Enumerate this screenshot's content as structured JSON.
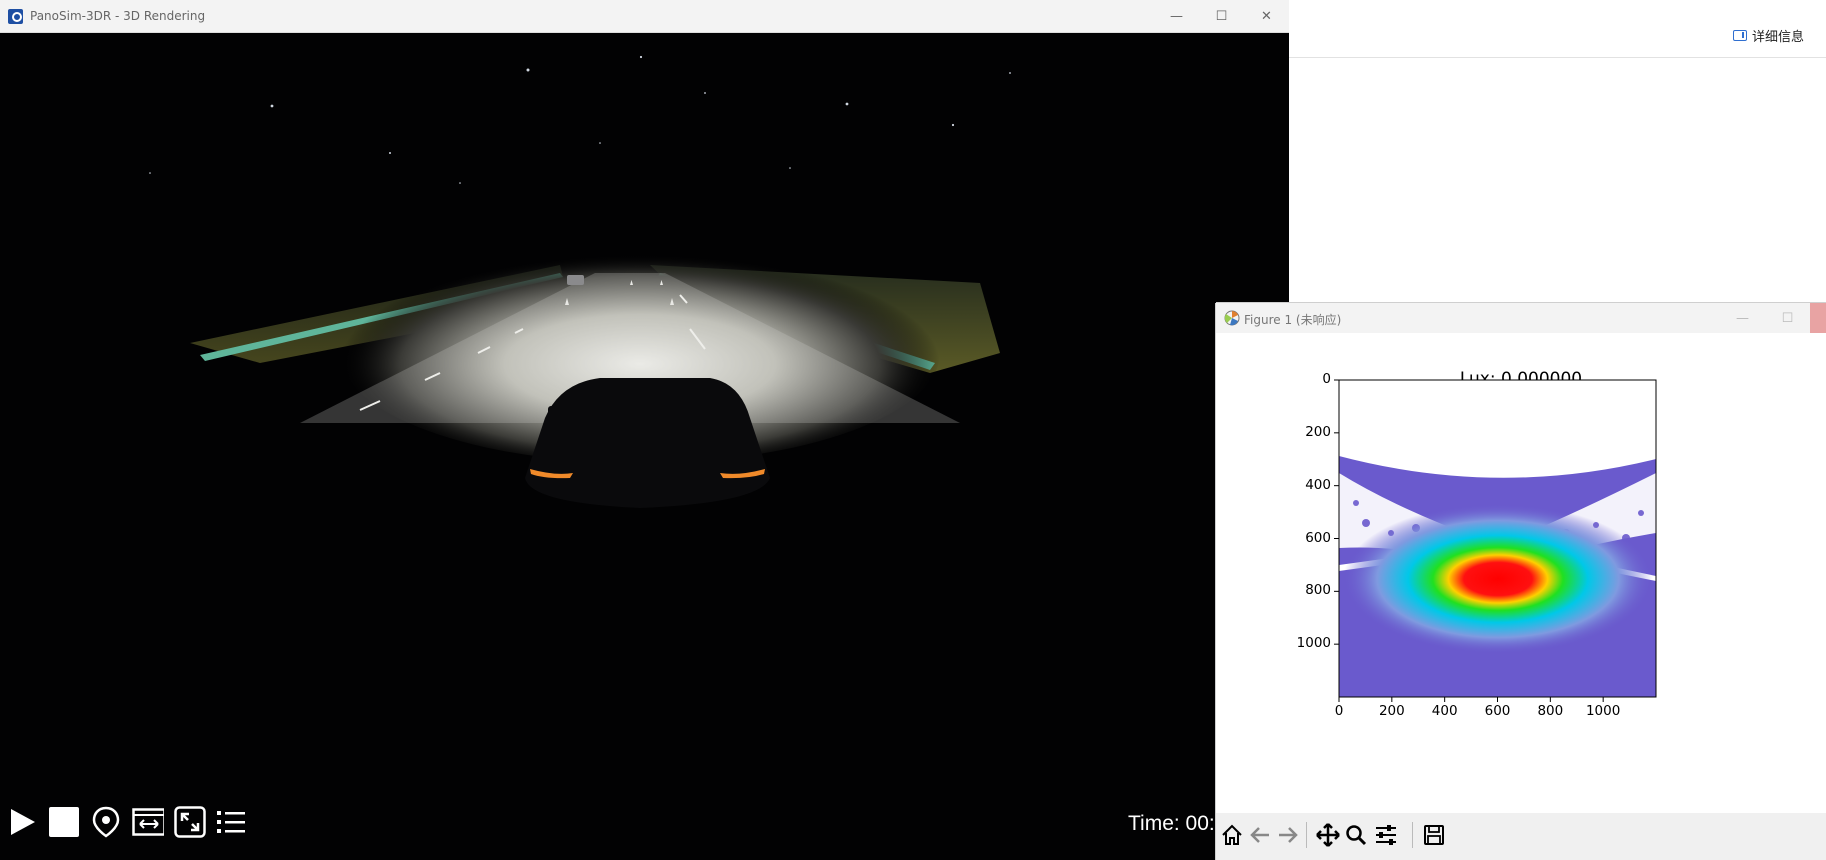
{
  "background_app": {
    "details_label": "详细信息"
  },
  "panosim_window": {
    "title": "PanoSim-3DR - 3D Rendering",
    "controls": [
      "minimize-icon",
      "maximize-icon",
      "close-icon"
    ],
    "toolbar": [
      "play-icon",
      "stop-icon",
      "location-icon",
      "switch-view-icon",
      "fullscreen-icon",
      "list-icon"
    ],
    "time_label": "Time: 00:"
  },
  "figure_window": {
    "title": "Figure 1 (未响应)",
    "plot": {
      "title": "Lux: 0.000000",
      "y_ticks": [
        "0",
        "200",
        "400",
        "600",
        "800",
        "1000"
      ],
      "x_ticks": [
        "0",
        "200",
        "400",
        "600",
        "800",
        "1000"
      ]
    },
    "toolbar": [
      "home-icon",
      "back-icon",
      "forward-icon",
      "pan-icon",
      "zoom-icon",
      "configure-subplots-icon",
      "save-icon"
    ]
  },
  "chart_data": {
    "type": "heatmap",
    "title": "Lux: 0.000000",
    "xlabel": "",
    "ylabel": "",
    "xlim": [
      0,
      1200
    ],
    "ylim": [
      1200,
      0
    ],
    "x_ticks": [
      0,
      200,
      400,
      600,
      800,
      1000
    ],
    "y_ticks": [
      0,
      200,
      400,
      600,
      800,
      1000
    ],
    "hotspot_center": [
      600,
      750
    ],
    "colors": {
      "background": "#6a5acd",
      "no_data": "#ffffff",
      "peak": "#ff0000",
      "mid_high": "#ffff00",
      "mid": "#00e000",
      "low": "#00c8ff"
    }
  }
}
